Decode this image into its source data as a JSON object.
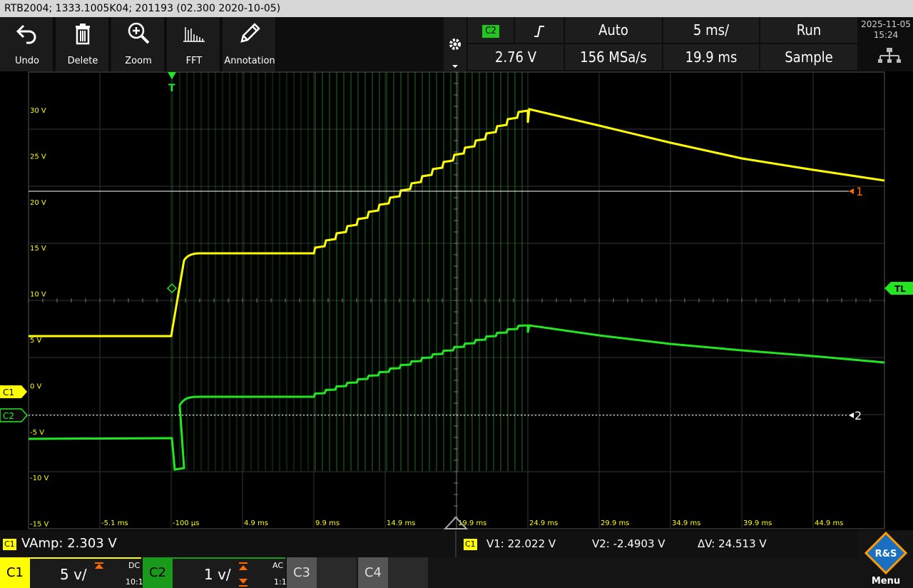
{
  "window_title": "RTB2004; 1333.1005K04; 201193 (02.300 2020-10-05)",
  "toolbar": [
    {
      "label": "Undo",
      "icon": "undo-icon"
    },
    {
      "label": "Delete",
      "icon": "trash-icon"
    },
    {
      "label": "Zoom",
      "icon": "zoom-icon"
    },
    {
      "label": "FFT",
      "icon": "fft-icon"
    },
    {
      "label": "Annotation",
      "icon": "pencil-icon"
    }
  ],
  "trigger": {
    "source": "C2",
    "slope_icon": "rising-edge-icon",
    "mode": "Auto",
    "level": "2.76 V"
  },
  "acquisition": {
    "timebase": "5 ms/",
    "sample_rate": "156 MSa/s",
    "position": "19.9 ms",
    "state": "Run",
    "mode": "Sample"
  },
  "datetime": {
    "date": "2025-11-05",
    "time": "15:24"
  },
  "network_icon": "network-icon",
  "y_axis_labels": [
    "30 V",
    "25 V",
    "20 V",
    "15 V",
    "10 V",
    "5 V",
    "0 V",
    "-5 V",
    "-10 V",
    "-15 V"
  ],
  "x_axis_labels": [
    "-5.1 ms",
    "-100 µs",
    "4.9 ms",
    "9.9 ms",
    "14.9 ms",
    "19.9 ms",
    "24.9 ms",
    "29.9 ms",
    "34.9 ms",
    "39.9 ms",
    "44.9 ms"
  ],
  "markers": {
    "trigger_marker": "T",
    "trigger_level_marker": "TL",
    "cursor1": "1",
    "cursor2": "2",
    "c1_offset": "C1",
    "c2_offset": "C2"
  },
  "measurement": {
    "channel": "C1",
    "label": "VAmp: 2.303 V"
  },
  "cursors": {
    "channel": "C1",
    "v1": "V1: 22.022 V",
    "v2": "V2: -2.4903 V",
    "dv": "ΔV: 24.513 V"
  },
  "channels": [
    {
      "name": "C1",
      "scale": "5 v/",
      "coupling": "DC",
      "probe": "10:1",
      "color": "#ffff00",
      "active": true
    },
    {
      "name": "C2",
      "scale": "1 v/",
      "coupling": "AC",
      "probe": "1:1",
      "color": "#00dd00",
      "active": true
    },
    {
      "name": "C3",
      "active": false
    },
    {
      "name": "C4",
      "active": false
    }
  ],
  "logo": {
    "text": "R&S",
    "label": "Menu"
  },
  "colors": {
    "ch1": "#ffff00",
    "ch2": "#22e622",
    "grid": "#3a3a3a",
    "marker_orange": "#ff6a00"
  }
}
